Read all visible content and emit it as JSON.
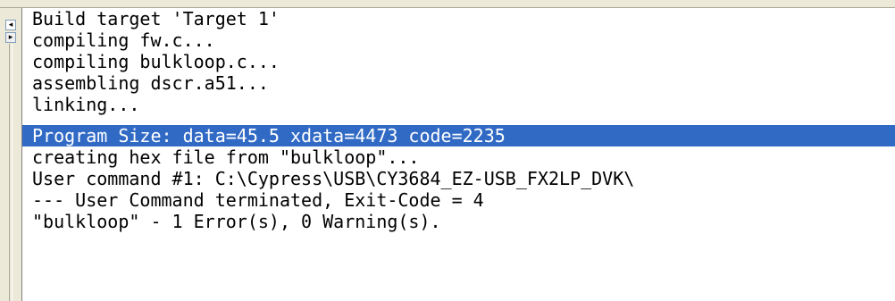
{
  "scroll": {
    "up_glyph": "◂",
    "down_glyph": "▸"
  },
  "output": {
    "selected_index": 5,
    "lines": [
      "Build target 'Target 1'",
      "compiling fw.c...",
      "compiling bulkloop.c...",
      "assembling dscr.a51...",
      "linking...",
      "Program Size: data=45.5 xdata=4473 code=2235",
      "creating hex file from \"bulkloop\"...",
      "User command #1: C:\\Cypress\\USB\\CY3684_EZ-USB_FX2LP_DVK\\",
      "--- User Command terminated, Exit-Code = 4",
      "\"bulkloop\" - 1 Error(s), 0 Warning(s)."
    ]
  },
  "colors": {
    "selection": "#316ac5",
    "selection_text": "#ffffff",
    "pane_background": "#ffffff"
  }
}
